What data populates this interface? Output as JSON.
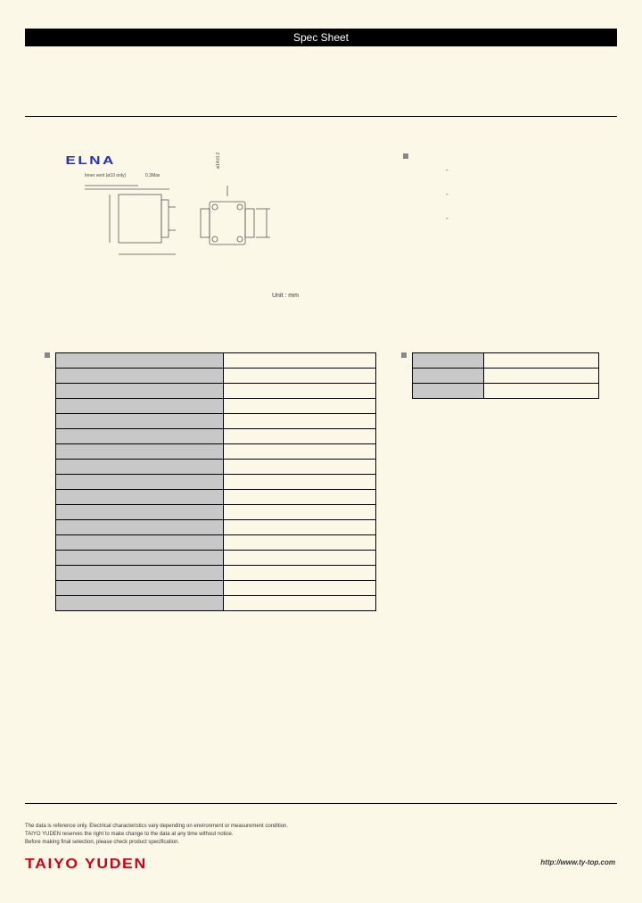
{
  "title": "Spec Sheet",
  "brand": "ELNA",
  "diagram": {
    "label1": "Inner vent (ø10 only)",
    "label2": "0.3Max",
    "label3": "ø14±0.2",
    "unit": "Unit : mm"
  },
  "dashes": [
    "-",
    "-",
    "-"
  ],
  "spec_rows": [
    {
      "label": "",
      "value": ""
    },
    {
      "label": "",
      "value": ""
    },
    {
      "label": "",
      "value": ""
    },
    {
      "label": "",
      "value": ""
    },
    {
      "label": "",
      "value": ""
    },
    {
      "label": "",
      "value": ""
    },
    {
      "label": "",
      "value": ""
    },
    {
      "label": "",
      "value": ""
    },
    {
      "label": "",
      "value": ""
    },
    {
      "label": "",
      "value": ""
    },
    {
      "label": "",
      "value": ""
    },
    {
      "label": "",
      "value": ""
    },
    {
      "label": "",
      "value": ""
    },
    {
      "label": "",
      "value": ""
    },
    {
      "label": "",
      "value": ""
    },
    {
      "label": "",
      "value": ""
    },
    {
      "label": "",
      "value": ""
    }
  ],
  "right_rows": [
    {
      "label": "",
      "value": ""
    },
    {
      "label": "",
      "value": ""
    },
    {
      "label": "",
      "value": ""
    }
  ],
  "disclaimer": {
    "line1": "The data is reference only. Electrical characteristics vary depending on environment or measurement condition.",
    "line2": "TAIYO YUDEN reserves the right to make change to the data at any time without notice.",
    "line3": "Before making final selection, please check product specification."
  },
  "footer_brand": "TAIYO YUDEN",
  "footer_url": "http://www.ty-top.com"
}
